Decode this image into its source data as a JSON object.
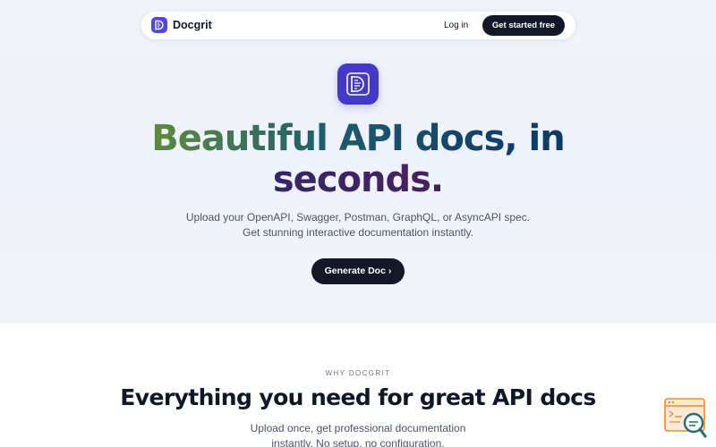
{
  "colors": {
    "accent": "#4f46e5",
    "dark_button": "#111827",
    "hero_background": "#eef2fa",
    "widget_orange": "#f08a2c",
    "widget_teal": "#1f6f7a"
  },
  "navbar": {
    "brand_name": "Docgrit",
    "brand_icon": "docgrit-logo-icon",
    "login_label": "Log in",
    "cta_label": "Get started free"
  },
  "hero": {
    "logo_icon": "docgrit-logo-icon",
    "headline_line1": "Beautiful API docs, in",
    "headline_line2": "seconds.",
    "subtext_line1": "Upload your OpenAPI, Swagger, Postman, GraphQL, or AsyncAPI spec.",
    "subtext_line2": "Get stunning interactive documentation instantly.",
    "generate_label": "Generate Doc ›"
  },
  "features": {
    "eyebrow": "WHY DOCGRIT",
    "title": "Everything you need for great API docs",
    "subtitle_line1": "Upload once, get professional documentation",
    "subtitle_line2": "instantly. No setup, no configuration."
  },
  "widget": {
    "icon": "search-docs-widget-icon"
  }
}
